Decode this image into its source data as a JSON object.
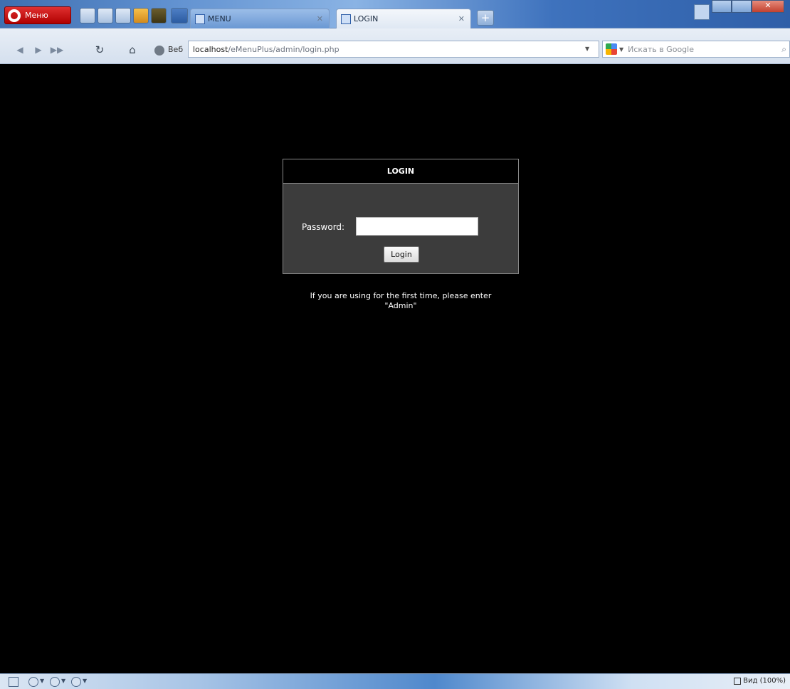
{
  "browser": {
    "menu_label": "Меню",
    "tabs": [
      {
        "title": "MENU",
        "active": false
      },
      {
        "title": "LOGIN",
        "active": true
      }
    ],
    "web_label": "Веб",
    "address": {
      "host": "localhost",
      "path": "/eMenuPlus/admin/login.php"
    },
    "search_placeholder": "Искать в Google",
    "zoom": "Вид (100%)"
  },
  "login": {
    "header": "LOGIN",
    "password_label": "Password:",
    "password_value": "",
    "button_label": "Login",
    "note_line1": "If you are using for the first time, please enter",
    "note_line2": "\"Admin\""
  },
  "colors": {
    "page_bg": "#000000",
    "panel_bg": "#3c3c3c",
    "opera_red": "#cc1a1a"
  }
}
